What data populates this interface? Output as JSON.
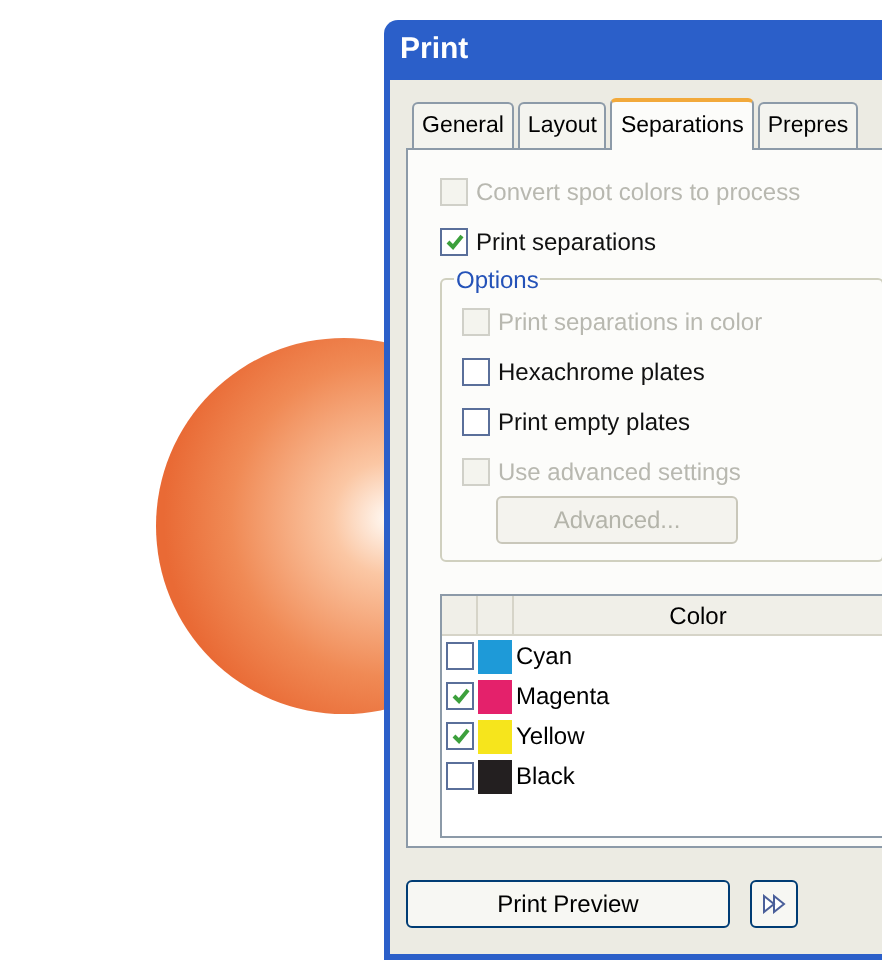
{
  "window": {
    "title": "Print"
  },
  "tabs": [
    {
      "label": "General",
      "selected": false
    },
    {
      "label": "Layout",
      "selected": false
    },
    {
      "label": "Separations",
      "selected": true
    },
    {
      "label": "Prepres",
      "selected": false
    }
  ],
  "top_options": [
    {
      "label": "Convert spot colors to process",
      "checked": false,
      "disabled": true
    },
    {
      "label": "Print separations",
      "checked": true,
      "disabled": false
    }
  ],
  "options_group": {
    "title": "Options",
    "items": [
      {
        "label": "Print separations in color",
        "checked": false,
        "disabled": true
      },
      {
        "label": "Hexachrome plates",
        "checked": false,
        "disabled": false
      },
      {
        "label": "Print empty plates",
        "checked": false,
        "disabled": false
      },
      {
        "label": "Use advanced settings",
        "checked": false,
        "disabled": true
      }
    ],
    "advanced_button": {
      "label": "Advanced...",
      "disabled": true
    }
  },
  "plates": {
    "column": "Color",
    "rows": [
      {
        "name": "Cyan",
        "checked": false,
        "color": "#1e9ad8"
      },
      {
        "name": "Magenta",
        "checked": true,
        "color": "#e4216b"
      },
      {
        "name": "Yellow",
        "checked": true,
        "color": "#f6e51c"
      },
      {
        "name": "Black",
        "checked": false,
        "color": "#231f20"
      }
    ]
  },
  "footer": {
    "preview_button": "Print Preview"
  }
}
